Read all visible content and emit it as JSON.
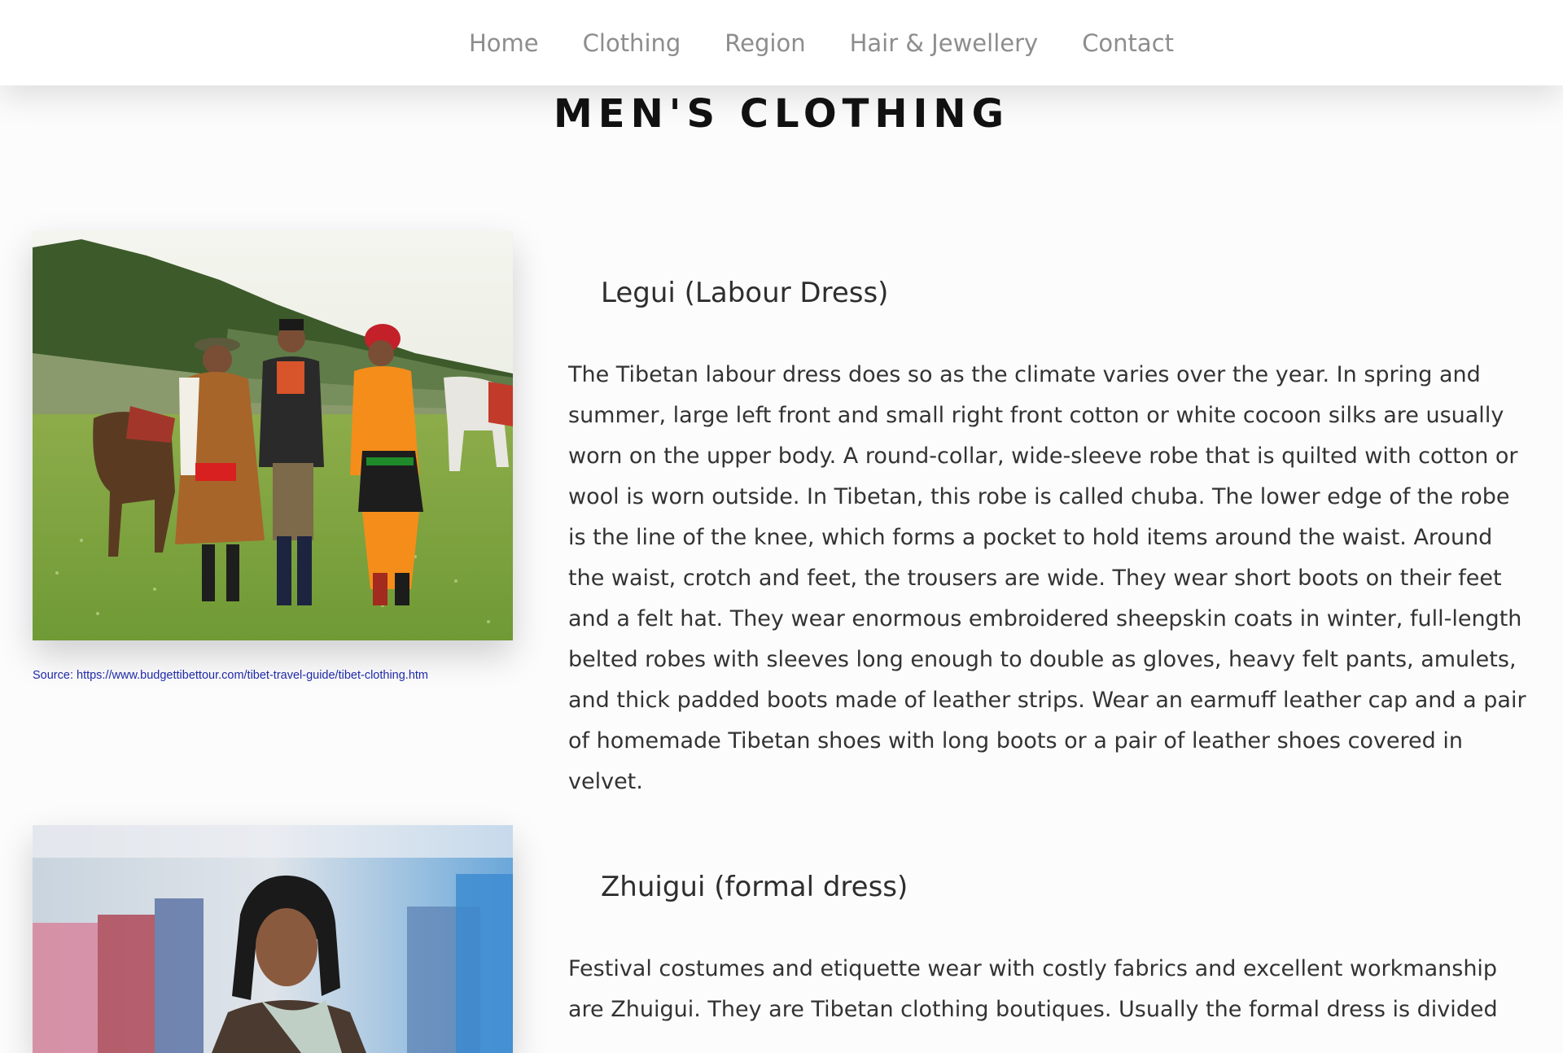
{
  "nav": {
    "items": [
      "Home",
      "Clothing",
      "Region",
      "Hair & Jewellery",
      "Contact"
    ]
  },
  "page": {
    "title": "MEN'S CLOTHING"
  },
  "sections": [
    {
      "heading": "Legui (Labour Dress)",
      "image_alt": "Three Tibetan men in traditional robes standing with horses in a grassy valley",
      "caption": "Source: https://www.budgettibettour.com/tibet-travel-guide/tibet-clothing.htm",
      "body": "The Tibetan labour dress does so as the climate varies over the year. In spring and summer, large left front and small right front cotton or white cocoon silks are usually worn on the upper body. A round-collar, wide-sleeve robe that is quilted with cotton or wool is worn outside. In Tibetan, this robe is called chuba. The lower edge of the robe is the line of the knee, which forms a pocket to hold items around the waist. Around the waist, crotch and feet, the trousers are wide. They wear short boots on their feet and a felt hat. They wear enormous embroidered sheepskin coats in winter, full-length belted robes with sleeves long enough to double as gloves, heavy felt pants, amulets, and thick padded boots made of leather strips. Wear an earmuff leather cap and a pair of homemade Tibetan shoes with long boots or a pair of leather shoes covered in velvet."
    },
    {
      "heading": "Zhuigui (formal dress)",
      "image_alt": "Portrait of a Tibetan man with long black hair and a light scarf",
      "body": "Festival costumes and etiquette wear with costly fabrics and excellent workmanship are Zhuigui. They are Tibetan clothing boutiques. Usually the formal dress is divided"
    }
  ],
  "colors": {
    "nav_text": "#8d8d8d",
    "title_text": "#111111",
    "caption_link": "#1f2aa6",
    "body_text": "#333333",
    "background": "#fcfcfd"
  }
}
